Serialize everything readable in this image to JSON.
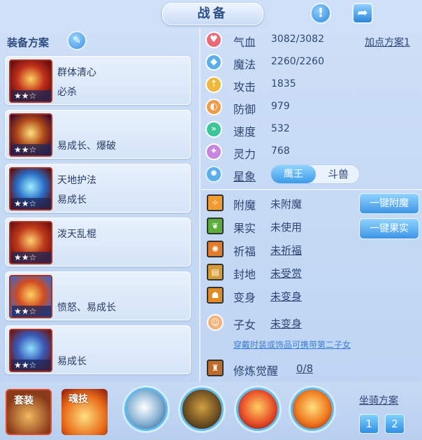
{
  "title": "战备",
  "top_icons": {
    "info": "exclamation-icon",
    "share": "share-icon"
  },
  "left": {
    "plan_title": "装备方案",
    "items": [
      {
        "line1": "群体清心",
        "line2": "必杀",
        "stars": "★★☆"
      },
      {
        "line1": "",
        "line2": "易成长、爆破",
        "stars": "★★☆"
      },
      {
        "line1": "天地护法",
        "line2": "易成长",
        "stars": "★★☆"
      },
      {
        "line1": "泼天乱棍",
        "line2": "",
        "stars": "★★☆"
      },
      {
        "line1": "",
        "line2": "愤怒、易成长",
        "stars": "★★☆"
      },
      {
        "line1": "",
        "line2": "易成长",
        "stars": "★★☆"
      }
    ]
  },
  "stats": {
    "add_plan": "加点方案1",
    "rows": [
      {
        "name": "气血",
        "value": "3082/3082",
        "color": "#e96a78",
        "glyph": "♥"
      },
      {
        "name": "魔法",
        "value": "2260/2260",
        "color": "#5aaeea",
        "glyph": "◆"
      },
      {
        "name": "攻击",
        "value": "1835",
        "color": "#f0b838",
        "glyph": "↑"
      },
      {
        "name": "防御",
        "value": "979",
        "color": "#f09a4a",
        "glyph": "◐"
      },
      {
        "name": "速度",
        "value": "532",
        "color": "#3cc49a",
        "glyph": "»"
      },
      {
        "name": "灵力",
        "value": "768",
        "color": "#c884e0",
        "glyph": "✦"
      }
    ],
    "star": {
      "label": "星象",
      "opt1": "鹰王",
      "opt2": "斗兽"
    }
  },
  "enhance": {
    "rows": [
      {
        "name": "附魔",
        "value": "未附魔",
        "underline": false,
        "bg": "#f39b2e"
      },
      {
        "name": "果实",
        "value": "未使用",
        "underline": false,
        "bg": "#5cae3a"
      },
      {
        "name": "祈福",
        "value": "未祈福",
        "underline": true,
        "bg": "#e27b2a"
      },
      {
        "name": "封地",
        "value": "未受赏",
        "underline": true,
        "bg": "#d89a32"
      },
      {
        "name": "变身",
        "value": "未变身",
        "underline": true,
        "bg": "#e28b24"
      },
      {
        "name": "子女",
        "value": "未变身",
        "underline": true,
        "bg": "#f4b27a"
      }
    ],
    "btn_enchant": "一键附魔",
    "btn_fruit": "一键果实",
    "hint": "穿戴时装或饰品可携带第二子女",
    "awaken_label": "修炼觉醒",
    "awaken_value": "0/8"
  },
  "bottom": {
    "suit": "套装",
    "soul": "魂技",
    "mount_title": "坐骑方案",
    "mount_btns": [
      "1",
      "2"
    ]
  }
}
